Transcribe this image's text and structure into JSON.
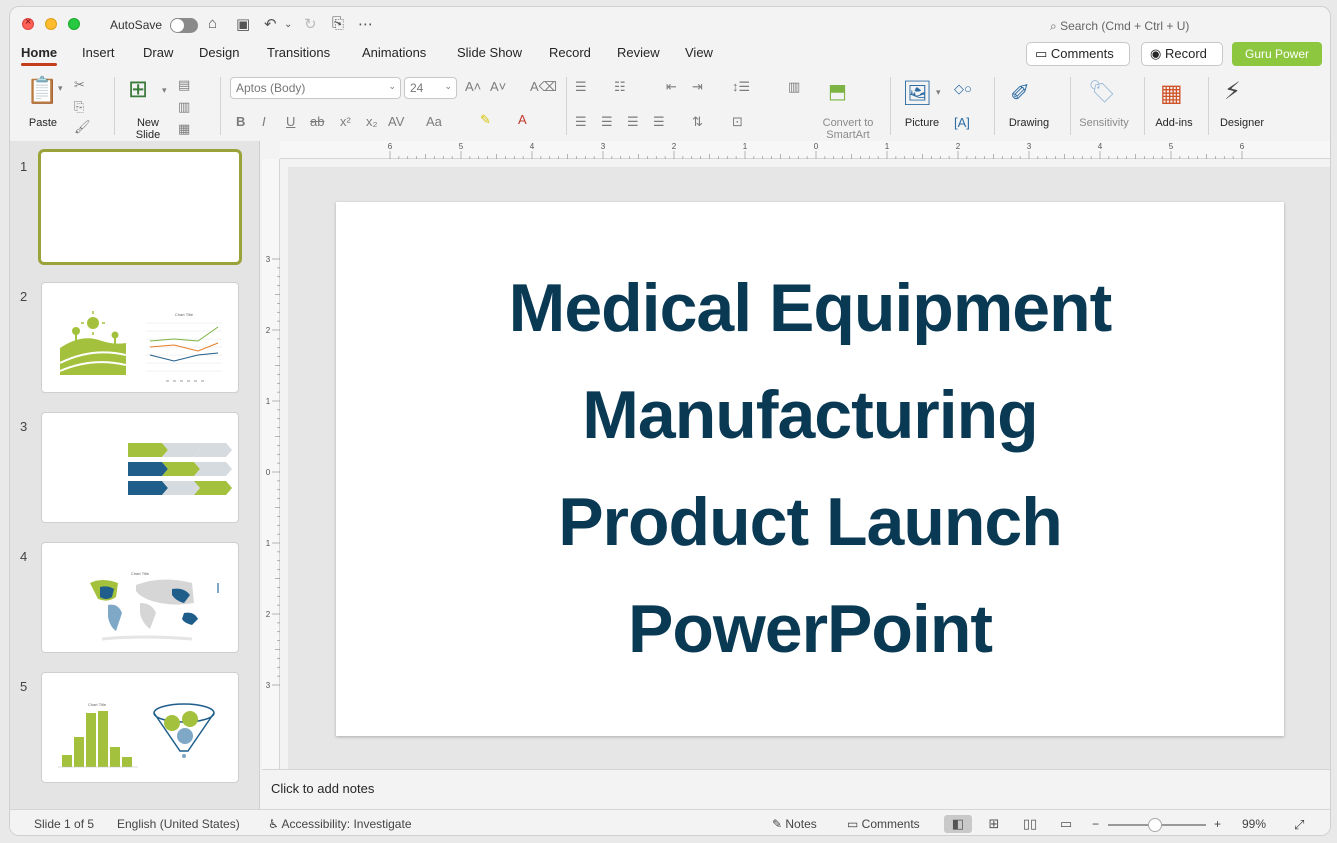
{
  "titlebar": {
    "autosave_label": "AutoSave",
    "search_placeholder": "Search (Cmd + Ctrl + U)"
  },
  "tabs": [
    "Home",
    "Insert",
    "Draw",
    "Design",
    "Transitions",
    "Animations",
    "Slide Show",
    "Record",
    "Review",
    "View"
  ],
  "right_buttons": {
    "comments": "Comments",
    "record": "Record",
    "guru": "Guru Power"
  },
  "ribbon": {
    "paste": "Paste",
    "new_slide": "New Slide",
    "font_name": "Aptos (Body)",
    "font_size": "24",
    "convert_smartart": "Convert to SmartArt",
    "picture": "Picture",
    "drawing": "Drawing",
    "sensitivity": "Sensitivity",
    "addins": "Add-ins",
    "designer": "Designer"
  },
  "slides": {
    "numbers": [
      "1",
      "2",
      "3",
      "4",
      "5"
    ],
    "thumb2_chart_title": "Chart Title",
    "thumb4_chart_title": "Chart Title",
    "thumb5_chart_title": "Chart Title"
  },
  "main_slide": {
    "title_line1": "Medical Equipment",
    "title_line2": "Manufacturing",
    "title_line3": "Product Launch",
    "title_line4": "PowerPoint"
  },
  "notes_placeholder": "Click to add notes",
  "status": {
    "slide_count": "Slide 1 of 5",
    "language": "English (United States)",
    "accessibility": "Accessibility: Investigate",
    "notes": "Notes",
    "comments": "Comments",
    "zoom": "99%"
  },
  "ruler_h_labels": [
    "6",
    "5",
    "4",
    "3",
    "2",
    "1",
    "0",
    "1",
    "2",
    "3",
    "4",
    "5",
    "6"
  ],
  "ruler_v_labels": [
    "3",
    "2",
    "1",
    "0",
    "1",
    "2",
    "3"
  ],
  "colors": {
    "accent_green": "#8dc63f",
    "title_navy": "#0a3954",
    "tab_underline": "#c43e1c",
    "thumb_blue": "#1f5e8a"
  }
}
